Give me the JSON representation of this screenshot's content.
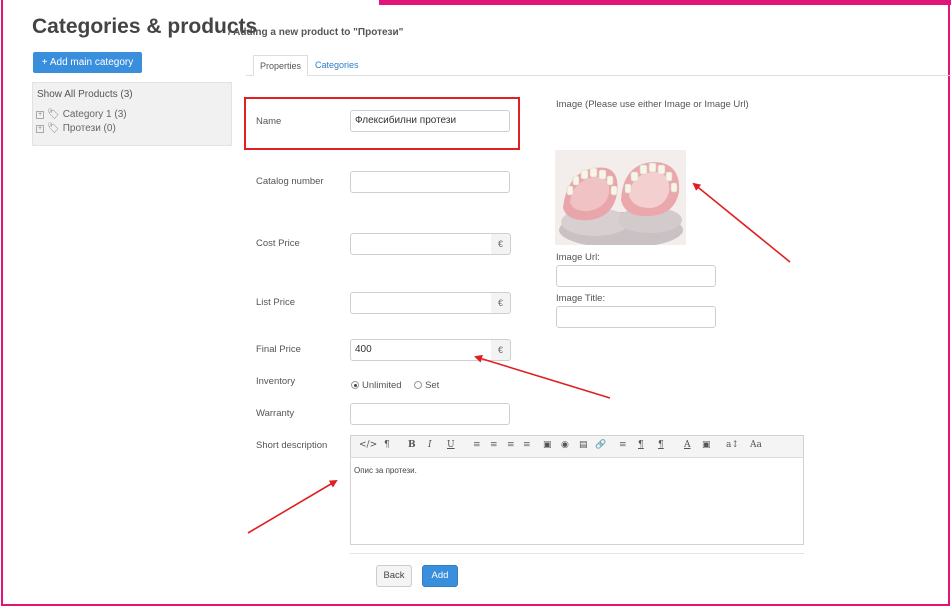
{
  "header": {
    "title": "Categories & products",
    "subtitle": "/ Adding a new product to \"Протези\""
  },
  "sidebar": {
    "add_main_category": "+ Add main category",
    "show_all": "Show All Products (3)",
    "items": [
      {
        "label": "Category 1 (3)"
      },
      {
        "label": "Протези (0)"
      }
    ]
  },
  "tabs": [
    {
      "label": "Properties",
      "active": true
    },
    {
      "label": "Categories",
      "active": false
    }
  ],
  "form": {
    "name_label": "Name",
    "name_value": "Флексибилни протези",
    "catalog_label": "Catalog number",
    "catalog_value": "",
    "cost_label": "Cost Price",
    "cost_value": "",
    "list_label": "List Price",
    "list_value": "",
    "final_label": "Final Price",
    "final_value": "400",
    "currency": "€",
    "inventory_label": "Inventory",
    "inventory_options": [
      "Unlimited",
      "Set"
    ],
    "inventory_selected": "Unlimited",
    "warranty_label": "Warranty",
    "warranty_value": "",
    "short_desc_label": "Short description",
    "short_desc_value": "Опис за протези."
  },
  "image_panel": {
    "hint": "Image (Please use either Image or Image Url)",
    "url_label": "Image Url:",
    "url_value": "",
    "title_label": "Image Title:",
    "title_value": ""
  },
  "editor_toolbar": [
    "</>",
    "¶",
    "B",
    "I",
    "U",
    "≡",
    "≡",
    "≡",
    "≡",
    "▣",
    "◉",
    "▤",
    "🔗",
    "≡",
    "¶",
    "¶",
    "A",
    "▣",
    "a↕",
    "Aa"
  ],
  "buttons": {
    "back": "Back",
    "add": "Add"
  },
  "colors": {
    "frame": "#e0157a",
    "accent": "#3a8fdc",
    "highlight": "#e02020",
    "arrow": "#e02020"
  }
}
